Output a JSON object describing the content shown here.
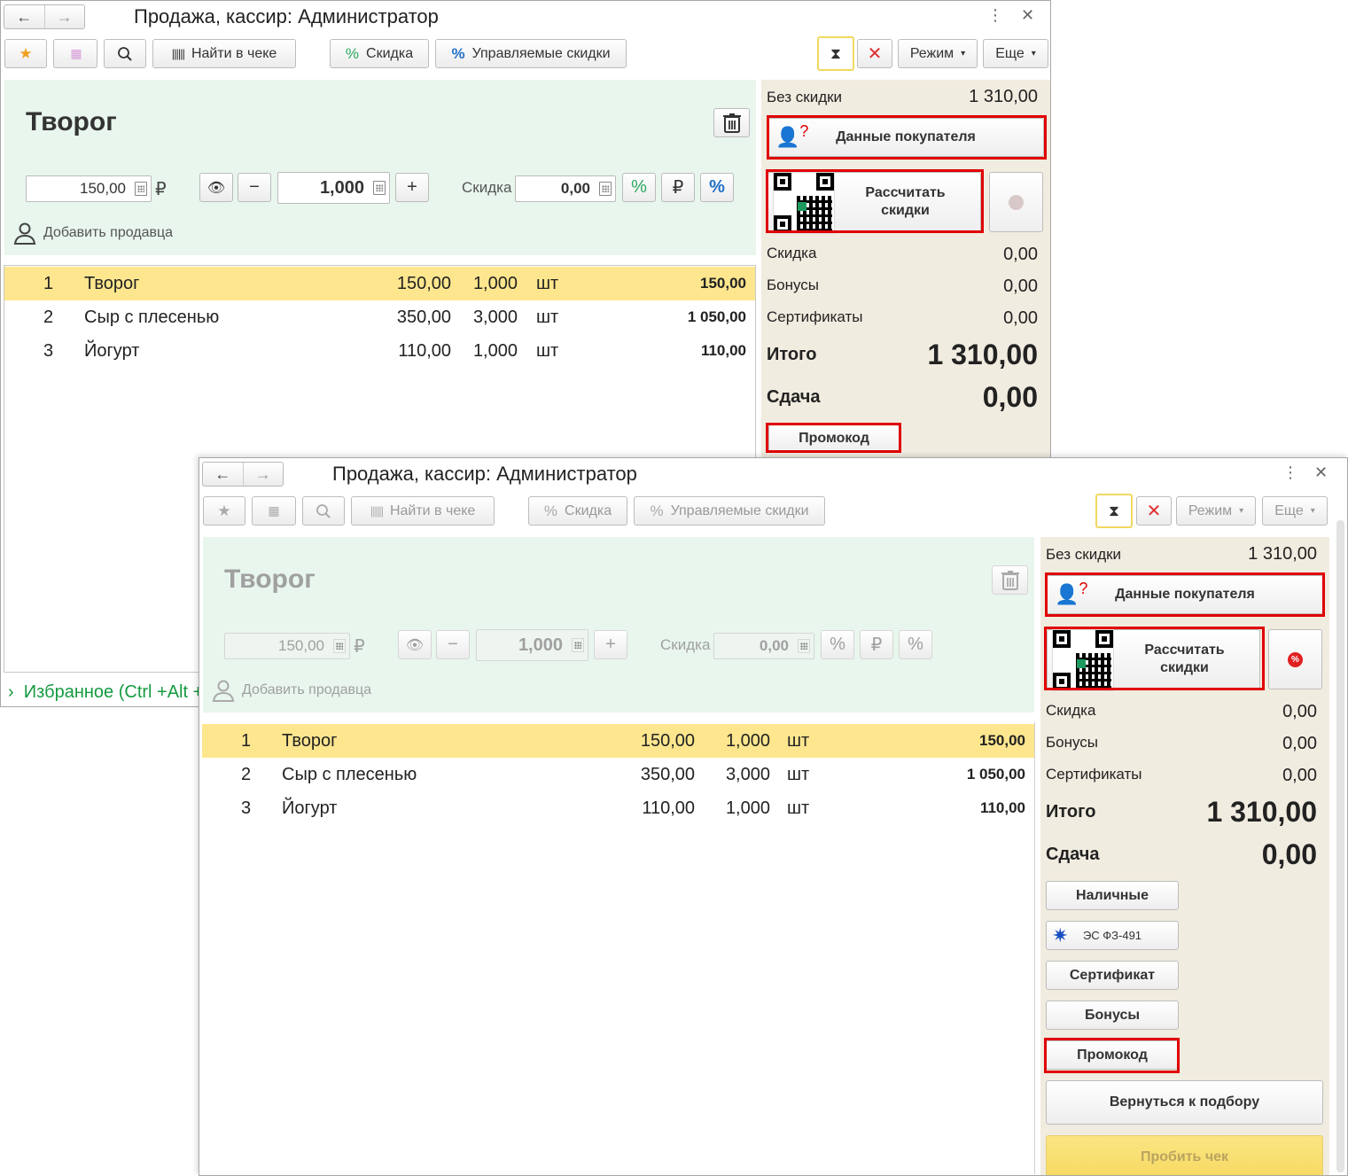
{
  "window": {
    "title": "Продажа, кассир: Администратор",
    "back": "←",
    "forward": "→",
    "menu": "⋮",
    "close": "✕"
  },
  "toolbar": {
    "find_in_check": "Найти в чеке",
    "discount": "Скидка",
    "managed_discounts": "Управляемые скидки",
    "mode": "Режим",
    "more": "Еще"
  },
  "product": {
    "name": "Творог",
    "price": "150,00",
    "currency": "₽",
    "quantity": "1,000",
    "discount_label": "Скидка",
    "discount_value": "0,00",
    "add_seller": "Добавить продавца"
  },
  "items": [
    {
      "n": "1",
      "name": "Творог",
      "price": "150,00",
      "qty": "1,000",
      "unit": "шт",
      "sum": "150,00"
    },
    {
      "n": "2",
      "name": "Сыр с плесенью",
      "price": "350,00",
      "qty": "3,000",
      "unit": "шт",
      "sum": "1 050,00"
    },
    {
      "n": "3",
      "name": "Йогурт",
      "price": "110,00",
      "qty": "1,000",
      "unit": "шт",
      "sum": "110,00"
    }
  ],
  "summary": {
    "no_discount_label": "Без скидки",
    "no_discount_value": "1 310,00",
    "buyer_data": "Данные покупателя",
    "calc_discounts_1": "Рассчитать",
    "calc_discounts_2": "скидки",
    "discount_label": "Скидка",
    "discount_value": "0,00",
    "bonuses_label": "Бонусы",
    "bonuses_value": "0,00",
    "certificates_label": "Сертификаты",
    "certificates_value": "0,00",
    "total_label": "Итого",
    "total_value": "1 310,00",
    "change_label": "Сдача",
    "change_value": "0,00",
    "promo": "Промокод"
  },
  "payment": {
    "cash": "Наличные",
    "es": "ЭС ФЗ-491",
    "certificate": "Сертификат",
    "bonuses": "Бонусы",
    "promo": "Промокод",
    "back_to_selection": "Вернуться к подбору",
    "print_check": "Пробить чек"
  },
  "favorites": "Избранное (Ctrl +Alt +",
  "colors": {
    "accent_red": "#e00000",
    "selected_row": "#fde68e",
    "top_zone": "#e8f6ee",
    "right_panel": "#f1ece0",
    "print_button": "#fbe37a"
  }
}
